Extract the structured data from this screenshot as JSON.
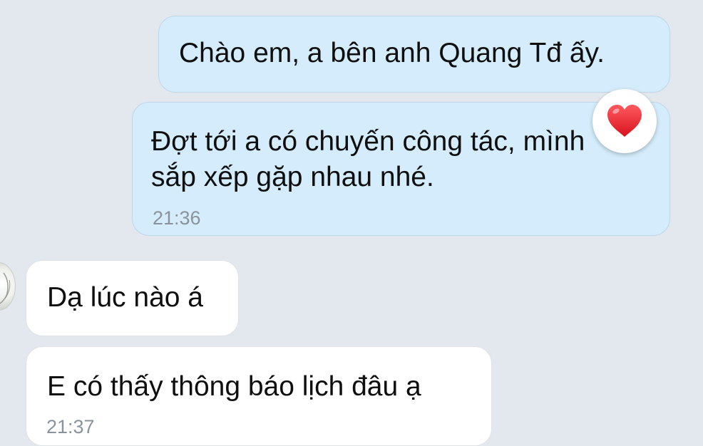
{
  "messages": [
    {
      "id": "msg1",
      "direction": "outgoing",
      "text": "Chào em, a bên anh Quang Tđ ấy.",
      "time": ""
    },
    {
      "id": "msg2",
      "direction": "outgoing",
      "text": "Đợt tới a có chuyến công tác, mình\nsắp xếp gặp nhau nhé.",
      "time": "21:36",
      "reaction": "heart-icon"
    },
    {
      "id": "msg3",
      "direction": "incoming",
      "text": "Dạ lúc nào á",
      "time": ""
    },
    {
      "id": "msg4",
      "direction": "incoming",
      "text": "E có thấy thông báo lịch đâu ạ",
      "time": "21:37"
    }
  ],
  "colors": {
    "background": "#e3e8ef",
    "outgoing_bubble": "#d4ecfb",
    "incoming_bubble": "#ffffff",
    "timestamp": "#8a939c",
    "reaction_heart": "#e8252f"
  },
  "icons": {
    "reaction": "heart-icon",
    "contact_avatar": "avatar"
  }
}
